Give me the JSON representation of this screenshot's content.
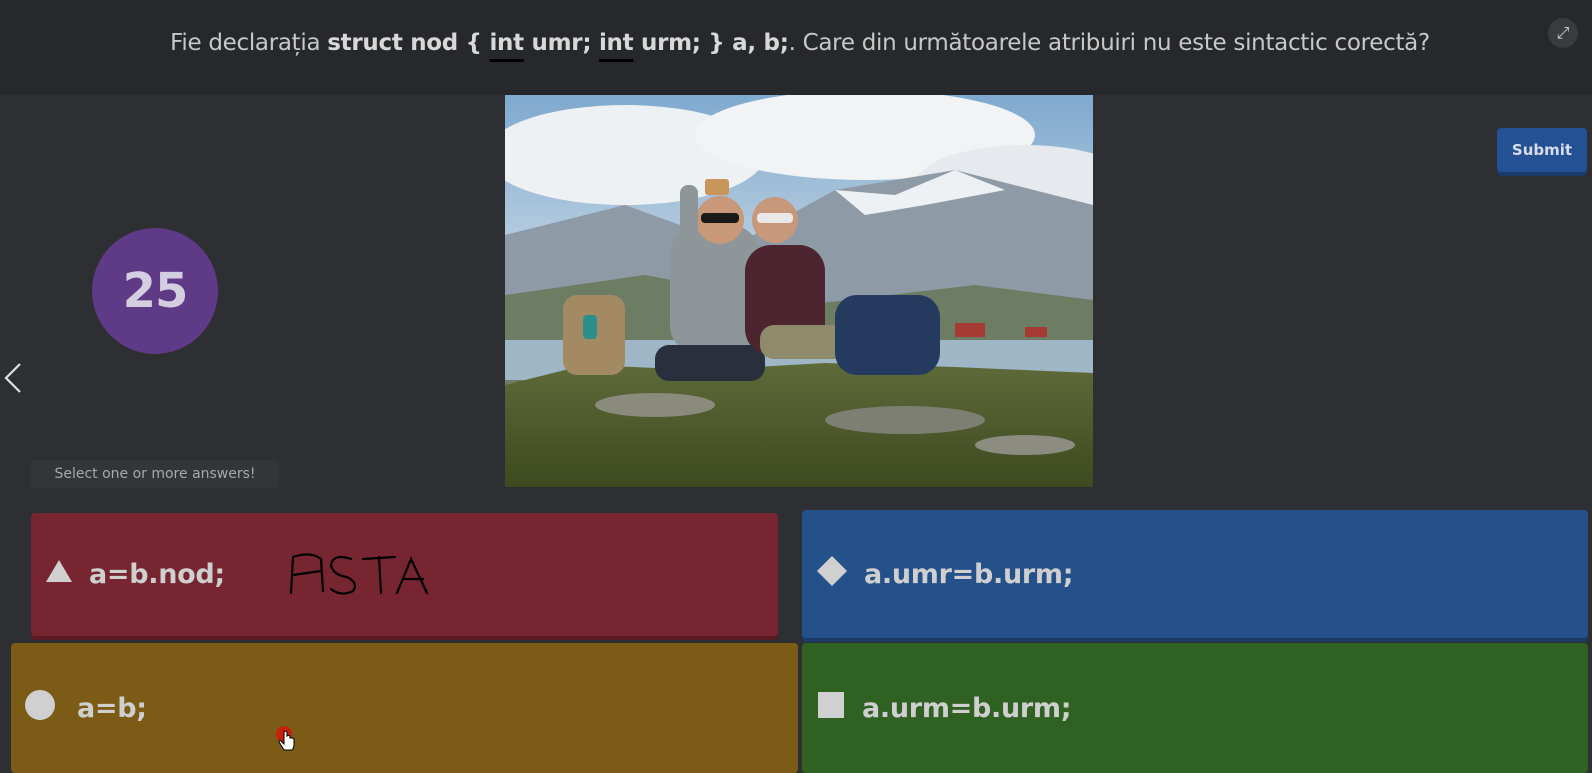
{
  "question": {
    "prefix": "Fie declarația ",
    "code_struct": "struct nod { ",
    "code_int1": "int",
    "code_umr": " umr; ",
    "code_int2": "int",
    "code_urm": " urm; } a, b;",
    "suffix": ". Care din următoarele atribuiri nu este sintactic corectă?"
  },
  "submit_label": "Submit",
  "timer_value": "25",
  "hint_text": "Select one or more answers!",
  "answers": [
    {
      "symbol": "triangle",
      "text": "a=b.nod;",
      "color": "#772631",
      "annotation": "ASTA"
    },
    {
      "symbol": "diamond",
      "text": "a.umr=b.urm;",
      "color": "#25518a"
    },
    {
      "symbol": "circle",
      "text": "a=b;",
      "color": "#7b5b16"
    },
    {
      "symbol": "square",
      "text": "a.urm=b.urm;",
      "color": "#2f6222"
    }
  ],
  "icons": {
    "expand": "expand-icon",
    "prev": "chevron-left-icon",
    "cursor": "hand-pointer-icon"
  }
}
